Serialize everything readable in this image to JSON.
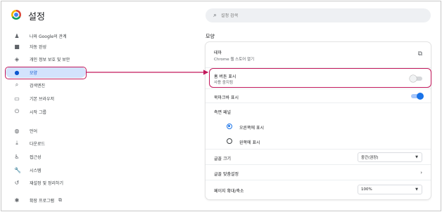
{
  "app": {
    "title": "설정"
  },
  "search": {
    "placeholder": "설정 검색",
    "icon": "search-icon"
  },
  "sidebar": {
    "items": [
      {
        "label": "나와 Google의 관계",
        "icon": "person-icon",
        "glyph": "♟"
      },
      {
        "label": "자동 완성",
        "icon": "autofill-icon",
        "glyph": "■"
      },
      {
        "label": "개인 정보 보호 및 보안",
        "icon": "shield-icon",
        "glyph": "◈"
      },
      {
        "label": "모양",
        "icon": "palette-icon",
        "glyph": "●",
        "active": true
      },
      {
        "label": "검색엔진",
        "icon": "search-icon",
        "glyph": "⌕"
      },
      {
        "label": "기본 브라우저",
        "icon": "browser-icon",
        "glyph": "▭"
      },
      {
        "label": "시작 그룹",
        "icon": "power-icon",
        "glyph": "⏻"
      },
      {
        "label": "언어",
        "icon": "globe-icon",
        "glyph": "◍"
      },
      {
        "label": "다운로드",
        "icon": "download-icon",
        "glyph": "⤓"
      },
      {
        "label": "접근성",
        "icon": "accessibility-icon",
        "glyph": "♿"
      },
      {
        "label": "시스템",
        "icon": "wrench-icon",
        "glyph": "🔧"
      },
      {
        "label": "재설정 및 정리하기",
        "icon": "reset-icon",
        "glyph": "↺"
      },
      {
        "label": "확장 프로그램",
        "icon": "extension-icon",
        "glyph": "✱"
      }
    ]
  },
  "main": {
    "section_title": "모양",
    "theme": {
      "title": "테마",
      "subtitle": "Chrome 웹 스토어 열기"
    },
    "home_button": {
      "title": "홈 버튼 표시",
      "subtitle": "사용 중지됨",
      "enabled": false
    },
    "bookmarks_bar": {
      "title": "북마크바 표시",
      "enabled": true
    },
    "side_panel": {
      "title": "측면 패널",
      "options": [
        {
          "label": "오른쪽에 표시",
          "checked": true
        },
        {
          "label": "왼쪽에 표시",
          "checked": false
        }
      ]
    },
    "font_size": {
      "title": "글꼴 크기",
      "value": "중간(권장)"
    },
    "customize_fonts": {
      "title": "글꼴 맞춤설정"
    },
    "page_zoom": {
      "title": "페이지 확대/축소",
      "value": "100%"
    }
  },
  "colors": {
    "accent": "#1a73e8",
    "highlight": "#c2185b",
    "active_bg": "#d3e3fd"
  }
}
